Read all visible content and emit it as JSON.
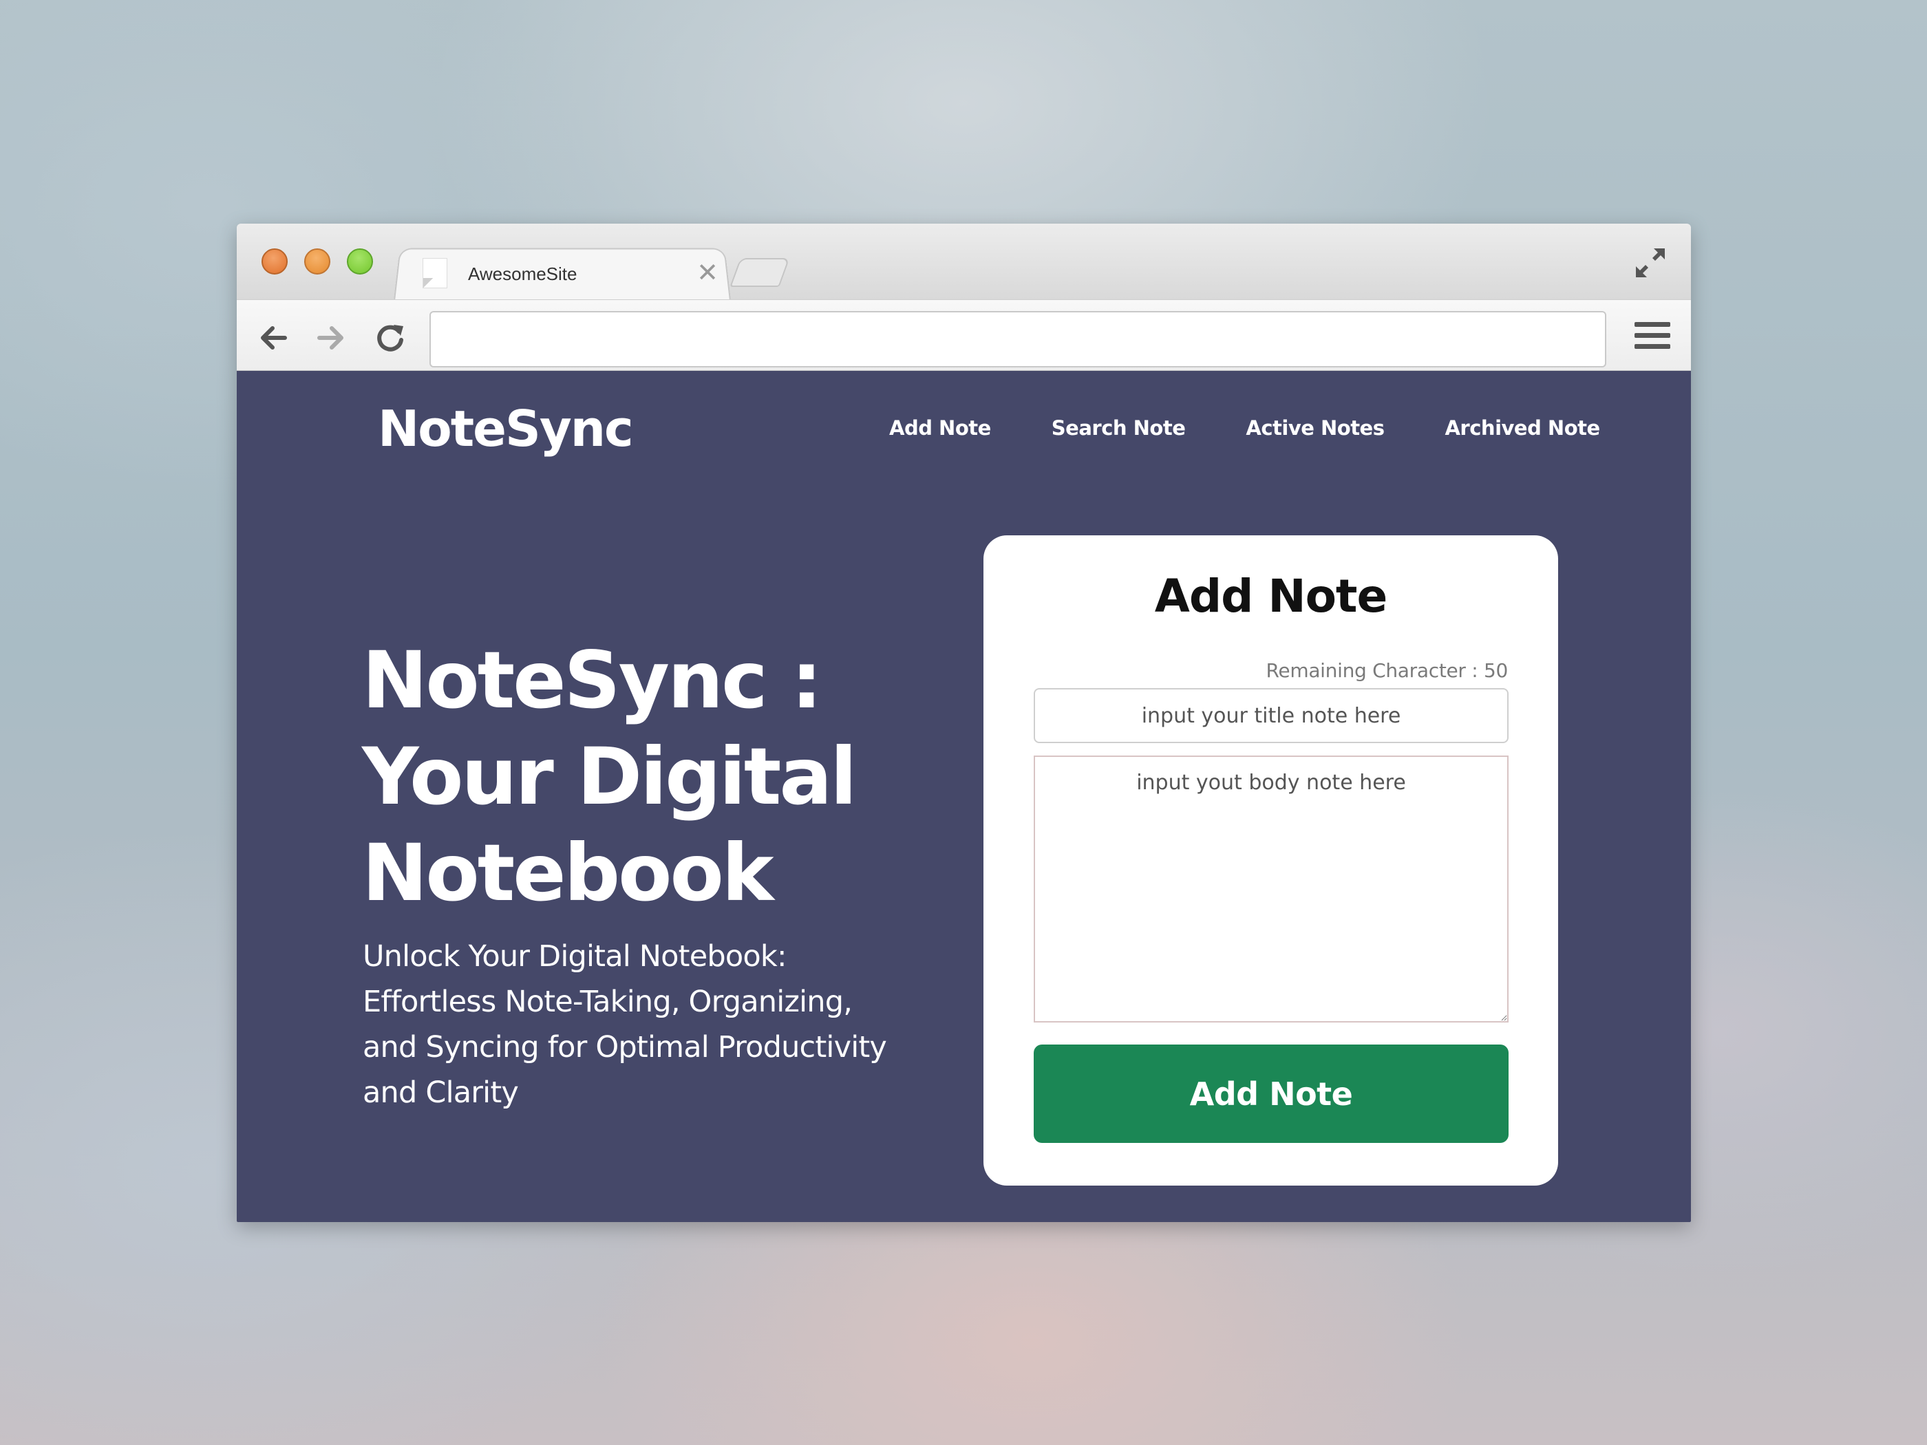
{
  "browser": {
    "tab_title": "AwesomeSite",
    "tab_close": "✕",
    "url": "",
    "icons": {
      "back": "arrow-left-icon",
      "forward": "arrow-right-icon",
      "reload": "reload-icon",
      "menu": "hamburger-menu-icon",
      "expand": "expand-icon"
    }
  },
  "header": {
    "brand": "NoteSync",
    "nav": [
      "Add Note",
      "Search Note",
      "Active Notes",
      "Archived Note"
    ]
  },
  "hero": {
    "title": "NoteSync : Your Digital Notebook",
    "subtitle": "Unlock Your Digital Notebook: Effortless Note-Taking, Organizing, and Syncing for Optimal Productivity and Clarity"
  },
  "form": {
    "title": "Add Note",
    "remaining": "Remaining Character : 50",
    "title_placeholder": "input your title note here",
    "body_placeholder": "input yout body note here",
    "submit_label": "Add Note"
  },
  "colors": {
    "page_bg": "#454869",
    "button_bg": "#1b8755",
    "card_bg": "#ffffff"
  }
}
